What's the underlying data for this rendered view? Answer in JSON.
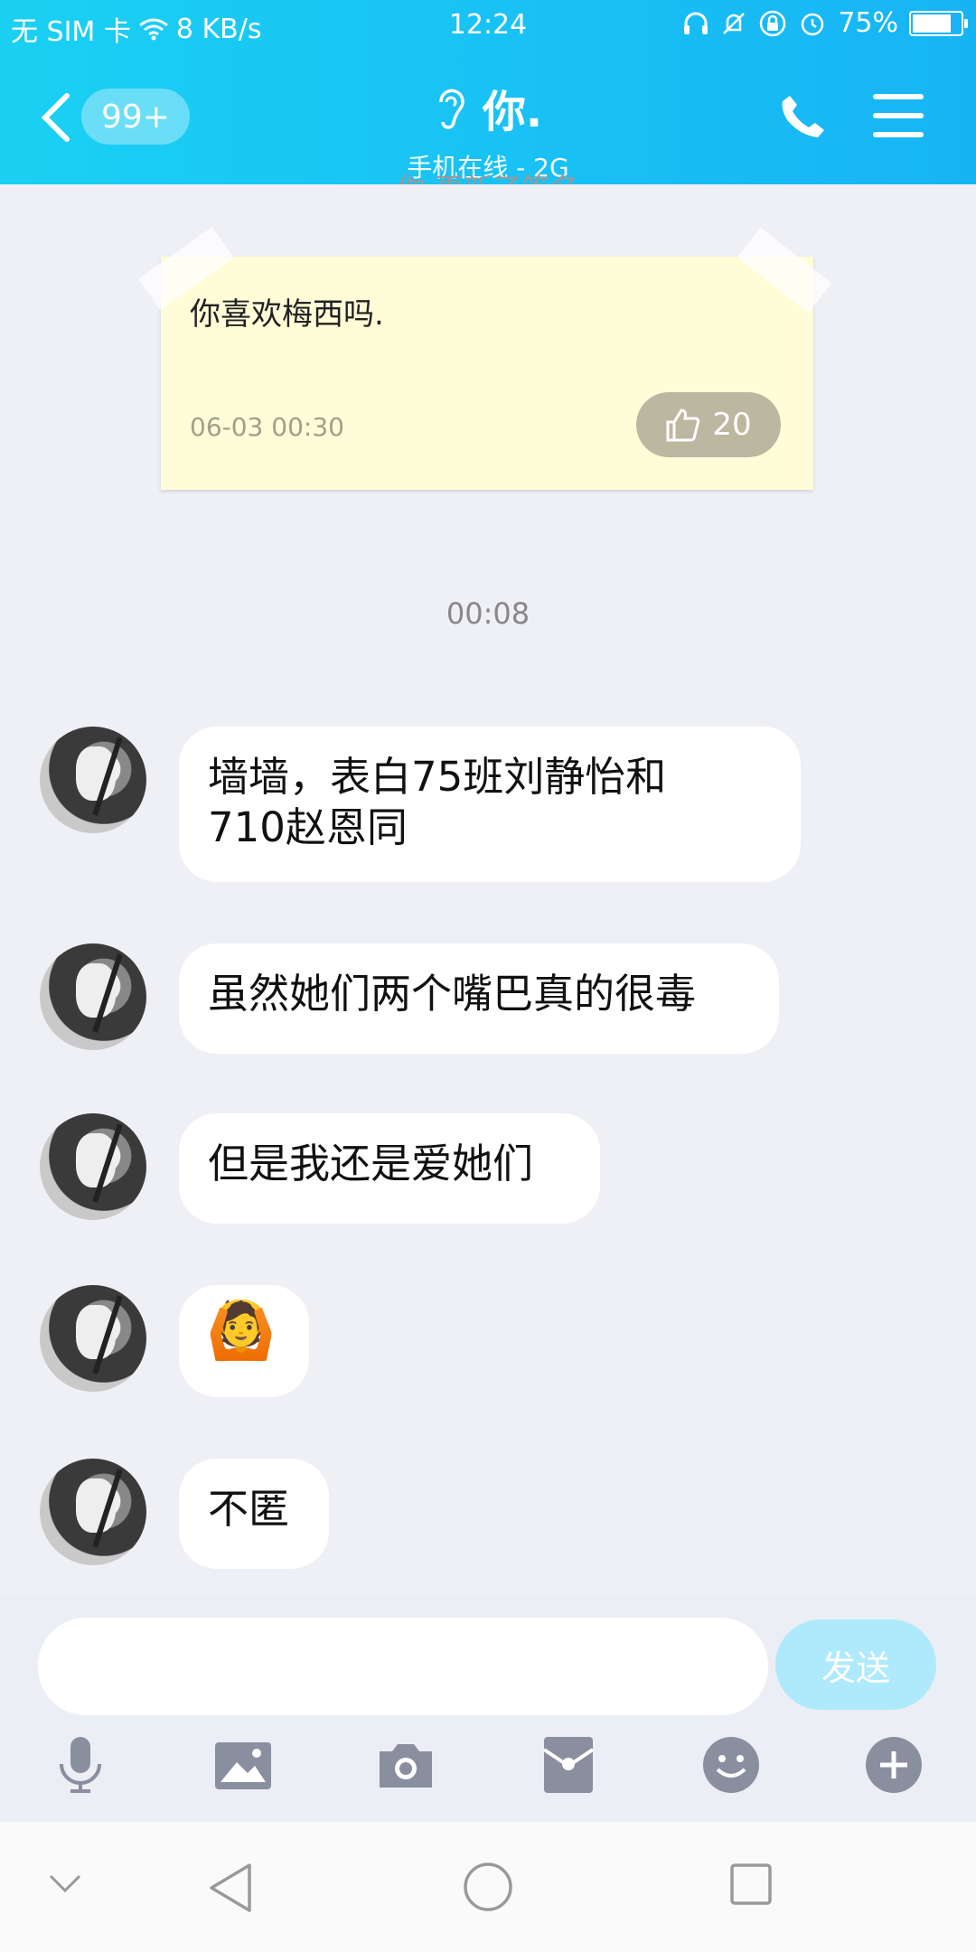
{
  "status_bar": {
    "carrier": "无 SIM 卡",
    "speed": "8 KB/s",
    "time": "12:24",
    "battery": "75%"
  },
  "header": {
    "unread": "99+",
    "title": "你.",
    "subtitle": "手机在线 - 2G"
  },
  "chat": {
    "top_notice": "你.更新了签名",
    "note": {
      "text": "你喜欢梅西吗.",
      "time": "06-03 00:30",
      "likes": "20"
    },
    "time_separator": "00:08",
    "messages": [
      {
        "text": "墙墙，表白75班刘静怡和\n710赵恩同"
      },
      {
        "text": "虽然她们两个嘴巴真的很毒"
      },
      {
        "text": "但是我还是爱她们"
      },
      {
        "text": "🙆"
      },
      {
        "text": "不匿"
      }
    ]
  },
  "composer": {
    "input_value": "",
    "send_label": "发送",
    "tools": [
      "microphone-icon",
      "image-icon",
      "camera-icon",
      "red-packet-icon",
      "emoji-icon",
      "plus-icon"
    ]
  },
  "colors": {
    "header": "#17c3f4",
    "send_disabled": "#aeeafb",
    "note": "#fffcd8"
  }
}
